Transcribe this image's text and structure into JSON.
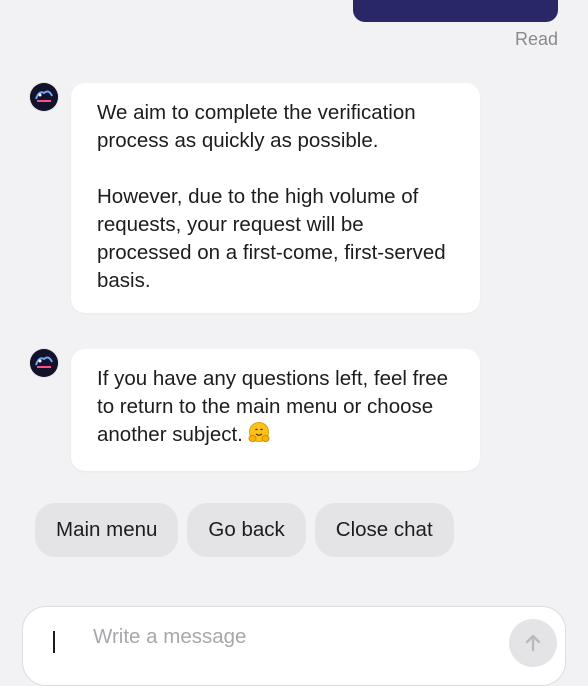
{
  "chat": {
    "previous_message_status": "Read",
    "messages": [
      {
        "sender": "bot",
        "paragraphs": [
          "We aim to complete the verification process as quickly as possible.",
          "However, due to the high volume of requests, your request will be processed on a first-come, first-served basis."
        ]
      },
      {
        "sender": "bot",
        "paragraphs": [
          "If you have any questions left, feel free to return to the main menu or choose another subject."
        ],
        "emoji": "hugging-face"
      }
    ],
    "quick_replies": [
      "Main menu",
      "Go back",
      "Close chat"
    ]
  },
  "composer": {
    "placeholder": "Write a message"
  },
  "icons": {
    "avatar": "casino-logo-avatar",
    "send": "send-arrow-icon"
  },
  "colors": {
    "user_bubble": "#2a2766",
    "background": "#f2f2f4",
    "bot_bubble": "#ffffff",
    "quick_reply": "#e4e4e7",
    "read_status": "#8a8a8e"
  }
}
